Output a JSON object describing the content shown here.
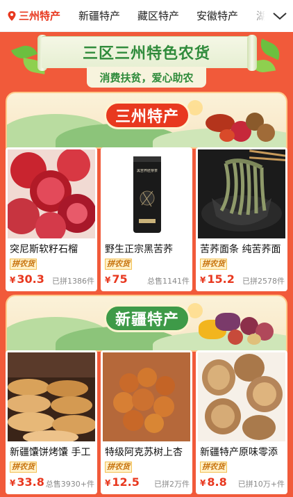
{
  "tabs": [
    {
      "label": "三州特产",
      "active": true
    },
    {
      "label": "新疆特产",
      "active": false
    },
    {
      "label": "藏区特产",
      "active": false
    },
    {
      "label": "安徽特产",
      "active": false
    },
    {
      "label": "湖",
      "active": false
    }
  ],
  "banner": {
    "title": "三区三州特色农货",
    "subtitle": "消费扶贫，爱心助农"
  },
  "sections": [
    {
      "title": "三州特产",
      "products": [
        {
          "name": "突尼斯软籽石榴",
          "tag": "拼农货",
          "currency": "¥",
          "price": "30.3",
          "sold": "已拼1386件"
        },
        {
          "name": "野生正宗黑苦荞",
          "tag": "拼农货",
          "currency": "¥",
          "price": "75",
          "sold": "总售1141件"
        },
        {
          "name": "苦荞面条 纯苦荞面",
          "tag": "拼农货",
          "currency": "¥",
          "price": "15.2",
          "sold": "已拼2578件"
        }
      ]
    },
    {
      "title": "新疆特产",
      "products": [
        {
          "name": "新疆馕饼烤馕 手工",
          "tag": "拼农货",
          "currency": "¥",
          "price": "33.8",
          "sold": "总售3930+件"
        },
        {
          "name": "特级阿克苏树上杏",
          "tag": "拼农货",
          "currency": "¥",
          "price": "12.5",
          "sold": "已拼2万件"
        },
        {
          "name": "新疆特产原味零添",
          "tag": "拼农货",
          "currency": "¥",
          "price": "8.8",
          "sold": "已拼10万+件"
        }
      ]
    }
  ],
  "product_image_text": {
    "tea_can_label": "黑苦荞胚芽茶"
  },
  "colors": {
    "brand_red": "#e8381f",
    "page_bg": "#f15a3a",
    "banner_green": "#2f8b3b",
    "section_green": "#3e9a48",
    "tag_yellow": "#fff1c9"
  },
  "icons": {
    "location": "location-pin-icon",
    "more": "chevron-down-icon"
  }
}
